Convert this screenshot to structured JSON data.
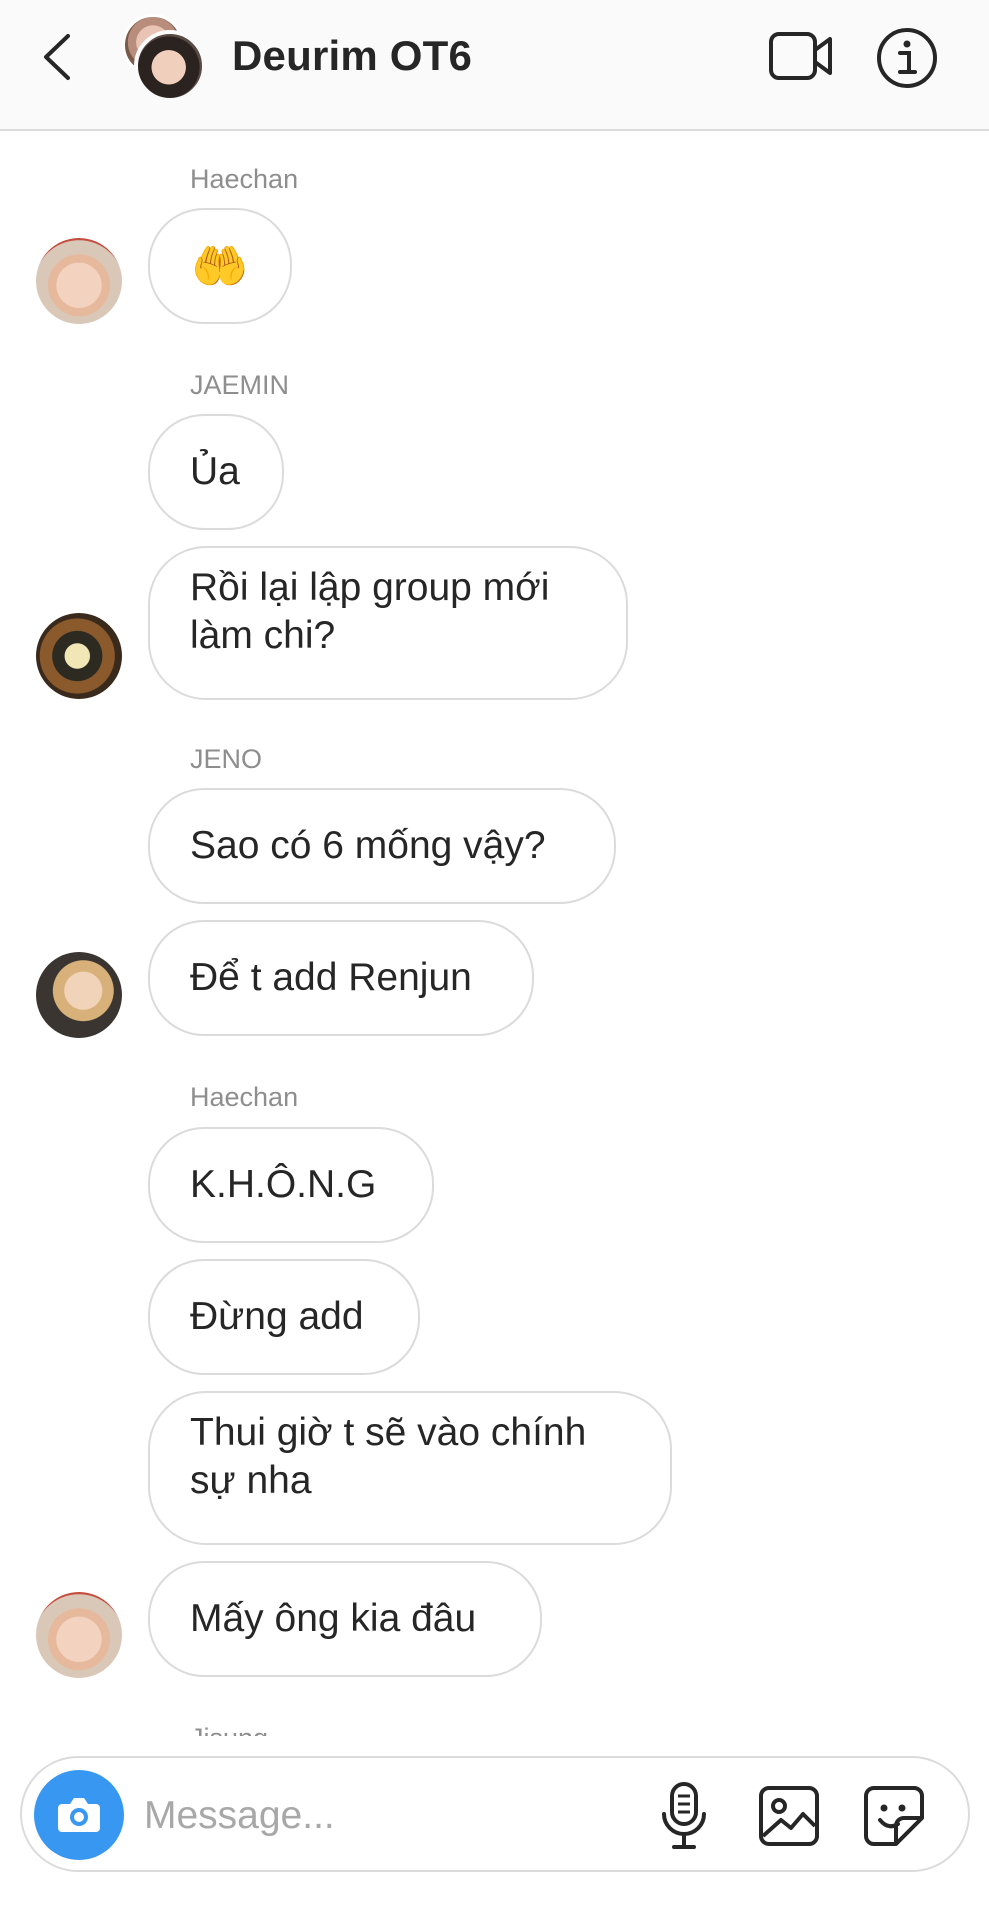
{
  "header": {
    "title": "Deurim OT6",
    "back_icon": "chevron-left-icon",
    "video_icon": "video-camera-icon",
    "info_icon": "info-icon"
  },
  "messages": [
    {
      "sender": "Haechan",
      "bubbles": [
        "🤲"
      ]
    },
    {
      "sender": "JAEMIN",
      "bubbles": [
        "Ủa",
        "Rồi lại lập group mới\nlàm chi?"
      ]
    },
    {
      "sender": "JENO",
      "bubbles": [
        "Sao có 6 mống vậy?",
        "Để t add Renjun"
      ]
    },
    {
      "sender": "Haechan",
      "bubbles": [
        "K.H.Ô.N.G",
        "Đừng add",
        "Thui giờ t sẽ vào chính\nsự nha",
        "Mấy ông kia đâu"
      ]
    }
  ],
  "next_sender_partial": "Jisung",
  "composer": {
    "placeholder": "Message...",
    "camera_icon": "camera-icon",
    "mic_icon": "microphone-icon",
    "gallery_icon": "gallery-icon",
    "sticker_icon": "sticker-icon"
  },
  "colors": {
    "accent": "#3897f0",
    "border": "#dbdbdb",
    "secondary_text": "#8e8e8e",
    "text": "#262626"
  }
}
